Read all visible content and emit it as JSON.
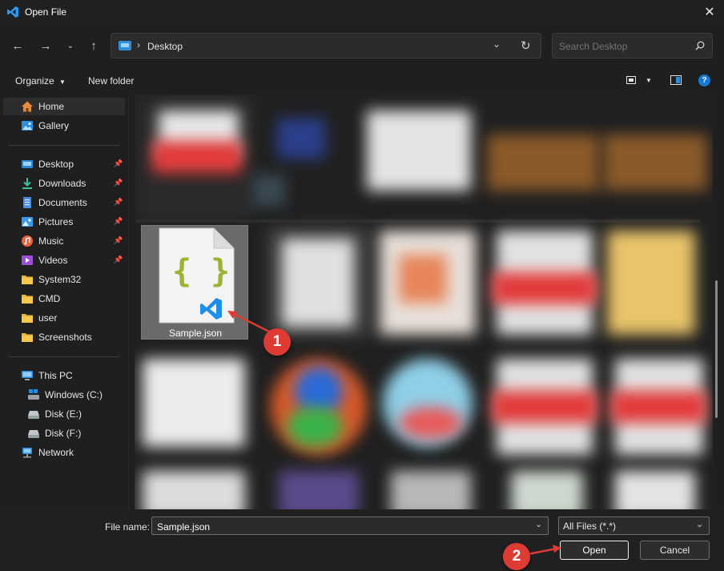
{
  "window": {
    "title": "Open File"
  },
  "address": {
    "location": "Desktop"
  },
  "search": {
    "placeholder": "Search Desktop"
  },
  "toolbar": {
    "organize": "Organize",
    "new_folder": "New folder"
  },
  "sidebar": {
    "items": [
      {
        "label": "Home"
      },
      {
        "label": "Gallery"
      },
      {
        "label": "Desktop"
      },
      {
        "label": "Downloads"
      },
      {
        "label": "Documents"
      },
      {
        "label": "Pictures"
      },
      {
        "label": "Music"
      },
      {
        "label": "Videos"
      },
      {
        "label": "System32"
      },
      {
        "label": "CMD"
      },
      {
        "label": "user"
      },
      {
        "label": "Screenshots"
      },
      {
        "label": "This PC"
      },
      {
        "label": "Windows (C:)"
      },
      {
        "label": "Disk (E:)"
      },
      {
        "label": "Disk (F:)"
      },
      {
        "label": "Network"
      }
    ]
  },
  "file": {
    "name": "Sample.json"
  },
  "bottom": {
    "filename_label": "File name:",
    "filename_value": "Sample.json",
    "filter": "All Files (*.*)",
    "open": "Open",
    "cancel": "Cancel"
  },
  "annotations": {
    "one": "1",
    "two": "2"
  },
  "colors": {
    "accent": "#0078d4",
    "badge": "#dd3b33",
    "json_brace": "#9bb533"
  }
}
